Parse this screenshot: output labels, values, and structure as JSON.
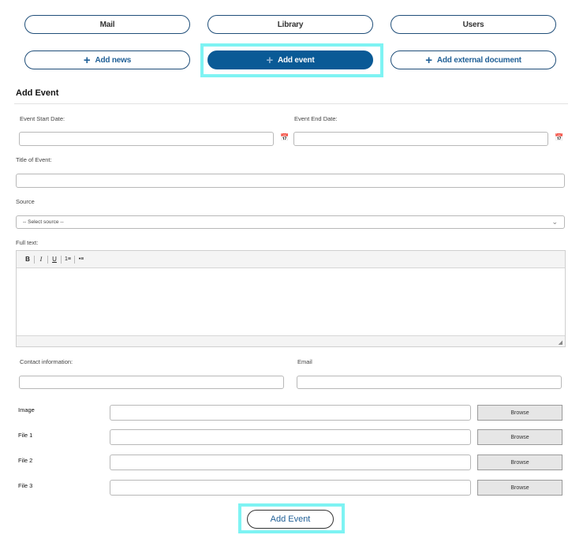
{
  "nav": {
    "mail": "Mail",
    "library": "Library",
    "users": "Users",
    "add_news": "Add news",
    "add_event": "Add event",
    "add_external_document": "Add external document"
  },
  "form": {
    "title": "Add Event",
    "event_start_date_label": "Event Start Date:",
    "event_end_date_label": "Event End Date:",
    "title_of_event_label": "Title of Event:",
    "source_label": "Source",
    "source_selected": "-- Select source --",
    "full_text_label": "Full text:",
    "contact_information_label": "Contact information:",
    "email_label": "Email",
    "image_label": "Image",
    "file1_label": "File 1",
    "file2_label": "File 2",
    "file3_label": "File 3",
    "browse_label": "Browse",
    "submit_label": "Add Event"
  },
  "editor_toolbar": {
    "bold": "B",
    "italic": "I",
    "underline": "U",
    "ordered_list": "1≡",
    "unordered_list": "•≡"
  },
  "icons": {
    "plus": "plus-icon",
    "calendar": "calendar-icon",
    "chevron": "chevron-down-icon",
    "resize": "resize-grip-icon"
  },
  "colors": {
    "accent": "#0a5a96",
    "link_text": "#1f5f96",
    "highlight": "#7ef3f3",
    "calendar_icon": "#2e8b57"
  }
}
